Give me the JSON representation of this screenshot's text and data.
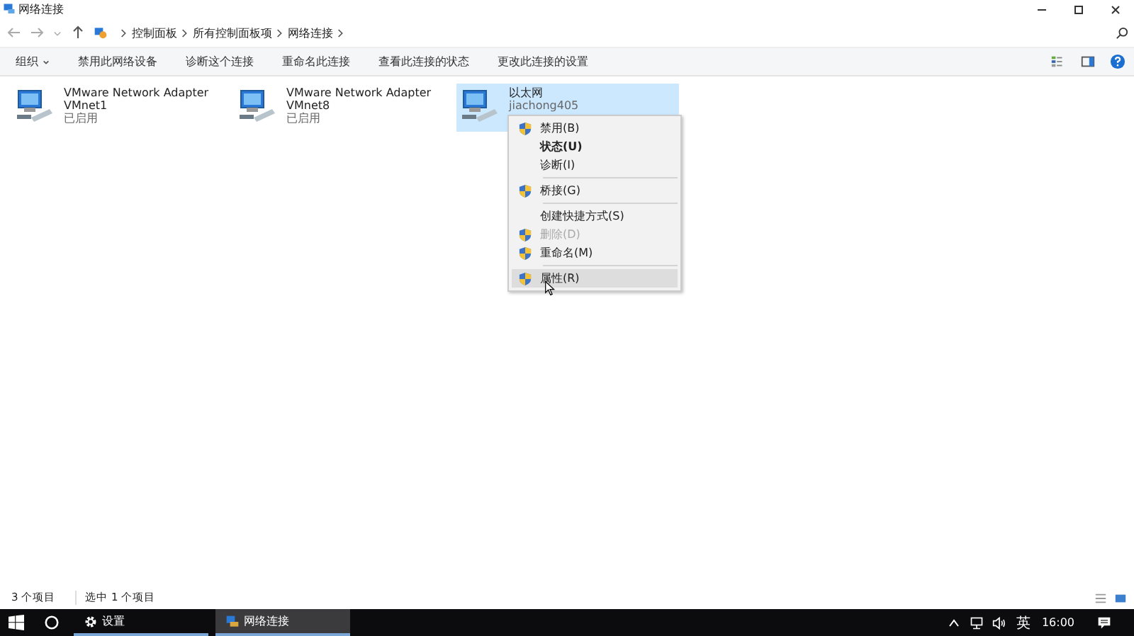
{
  "window": {
    "title": "网络连接"
  },
  "address_bar": {
    "breadcrumbs": [
      "控制面板",
      "所有控制面板项",
      "网络连接"
    ]
  },
  "toolbar": {
    "items": [
      {
        "label": "组织",
        "dropdown": true
      },
      {
        "label": "禁用此网络设备",
        "dropdown": false
      },
      {
        "label": "诊断这个连接",
        "dropdown": false
      },
      {
        "label": "重命名此连接",
        "dropdown": false
      },
      {
        "label": "查看此连接的状态",
        "dropdown": false
      },
      {
        "label": "更改此连接的设置",
        "dropdown": false
      }
    ]
  },
  "connections": [
    {
      "name": "VMware Network Adapter",
      "line2": "VMnet1",
      "line3": "已启用",
      "selected": false
    },
    {
      "name": "VMware Network Adapter",
      "line2": "VMnet8",
      "line3": "已启用",
      "selected": false
    },
    {
      "name": "以太网",
      "line2": "jiachong405",
      "selected": true
    }
  ],
  "context_menu": {
    "items": [
      {
        "kind": "item",
        "label": "禁用(B)",
        "shield": true,
        "bold": false,
        "disabled": false,
        "selected": false
      },
      {
        "kind": "item",
        "label": "状态(U)",
        "shield": false,
        "bold": true,
        "disabled": false,
        "selected": false
      },
      {
        "kind": "item",
        "label": "诊断(I)",
        "shield": false,
        "bold": false,
        "disabled": false,
        "selected": false
      },
      {
        "kind": "separator"
      },
      {
        "kind": "item",
        "label": "桥接(G)",
        "shield": true,
        "bold": false,
        "disabled": false,
        "selected": false
      },
      {
        "kind": "separator"
      },
      {
        "kind": "item",
        "label": "创建快捷方式(S)",
        "shield": false,
        "bold": false,
        "disabled": false,
        "selected": false
      },
      {
        "kind": "item",
        "label": "删除(D)",
        "shield": true,
        "bold": false,
        "disabled": true,
        "selected": false
      },
      {
        "kind": "item",
        "label": "重命名(M)",
        "shield": true,
        "bold": false,
        "disabled": false,
        "selected": false
      },
      {
        "kind": "separator"
      },
      {
        "kind": "item",
        "label": "属性(R)",
        "shield": true,
        "bold": false,
        "disabled": false,
        "selected": true
      }
    ]
  },
  "status_bar": {
    "item_count": "3 个项目",
    "selection": "选中 1 个项目"
  },
  "taskbar": {
    "apps": [
      {
        "label": "设置",
        "active": false
      },
      {
        "label": "网络连接",
        "active": true
      }
    ],
    "tray": {
      "input_method": "英",
      "time": "16:00"
    }
  }
}
